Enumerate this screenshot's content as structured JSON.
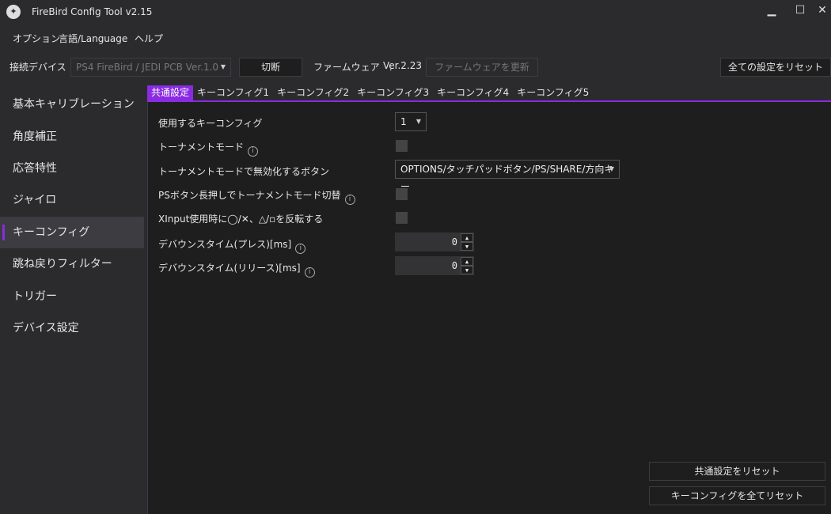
{
  "window": {
    "title": "FireBird Config Tool v2.15",
    "minimize": "▁",
    "maximize": "☐",
    "close": "✕"
  },
  "menu": [
    "オプション",
    "言語/Language",
    "ヘルプ"
  ],
  "toolbar": {
    "device_label": "接続デバイス",
    "device_value": "PS4 FireBird / JEDI PCB Ver.1.0",
    "disconnect": "切断",
    "firmware_label": "ファームウェア　:",
    "firmware_version": "Ver.2.23",
    "update_firmware": "ファームウェアを更新",
    "reset_all": "全ての設定をリセット"
  },
  "sidebar": {
    "items": [
      "基本キャリブレーション",
      "角度補正",
      "応答特性",
      "ジャイロ",
      "キーコンフィグ",
      "跳ね戻りフィルター",
      "トリガー",
      "デバイス設定"
    ],
    "selected": "キーコンフィグ"
  },
  "tabs": [
    "共通設定",
    "キーコンフィグ1",
    "キーコンフィグ2",
    "キーコンフィグ3",
    "キーコンフィグ4",
    "キーコンフィグ5"
  ],
  "settings": {
    "key_config_label": "使用するキーコンフィグ",
    "key_config_value": "1",
    "tournament_label": "トーナメントモード",
    "tournament_checked": false,
    "disabled_buttons_label": "トーナメントモードで無効化するボタン",
    "disabled_buttons_value": "OPTIONS/タッチパッドボタン/PS/SHARE/方向キー",
    "ps_hold_label": "PSボタン長押しでトーナメントモード切替",
    "ps_hold_checked": false,
    "xinput_label": "XInput使用時に◯/✕、△/▫を反転する",
    "xinput_checked": false,
    "debounce_press_label": "デバウンスタイム(プレス)[ms]",
    "debounce_press_value": "0",
    "debounce_release_label": "デバウンスタイム(リリース)[ms]",
    "debounce_release_value": "0"
  },
  "footer": {
    "reset_common": "共通設定をリセット",
    "reset_key_configs": "キーコンフィグを全てリセット"
  },
  "colors": {
    "accent": "#8a2be2",
    "background": "#2b2b2e",
    "panel": "#1e1e1e"
  }
}
